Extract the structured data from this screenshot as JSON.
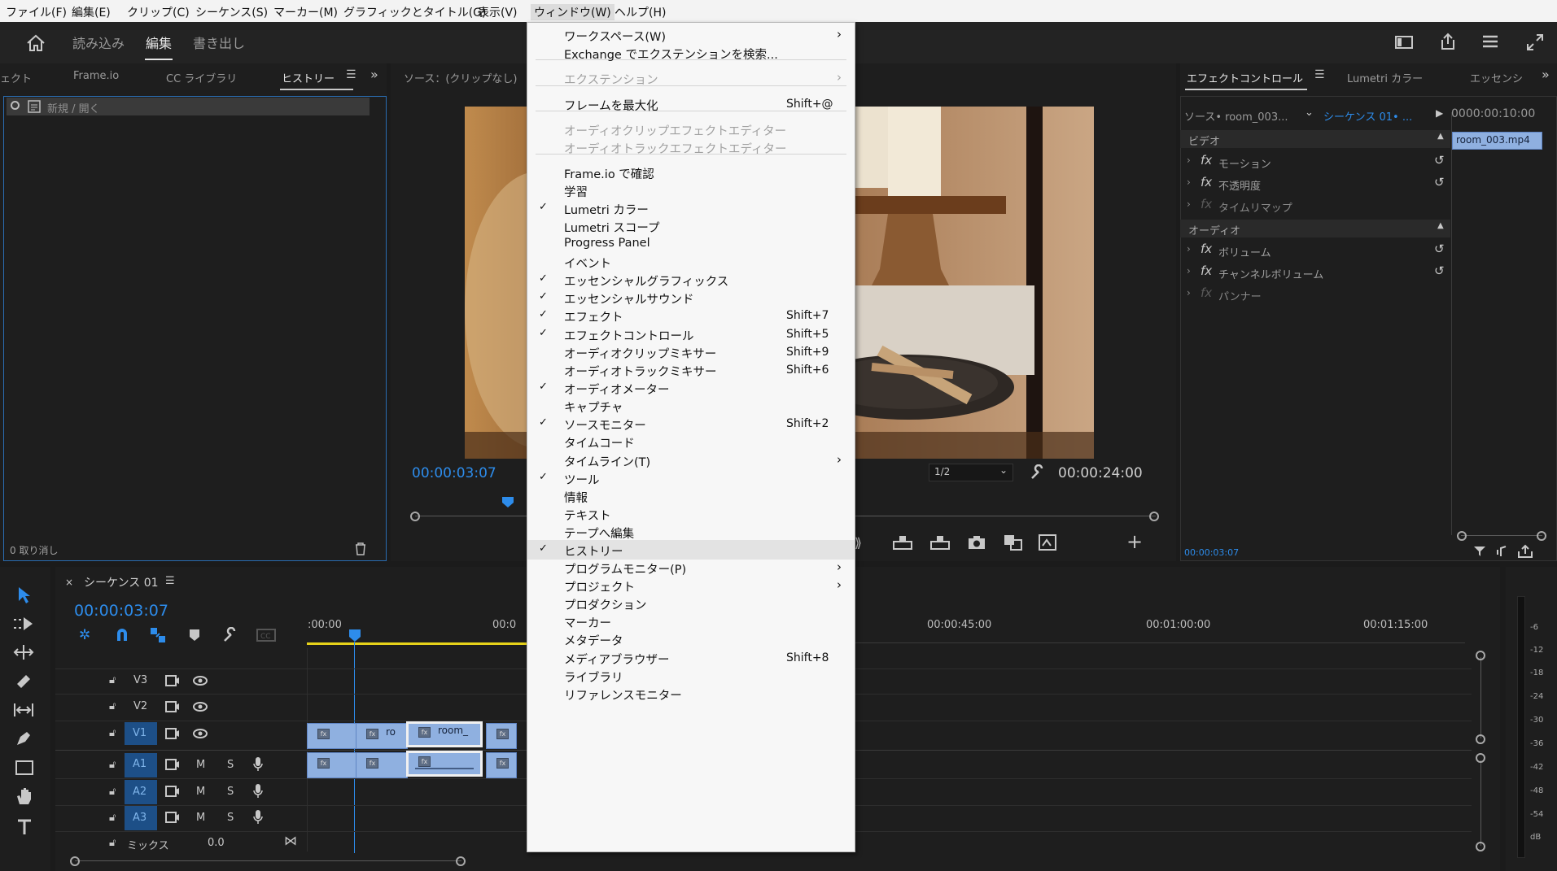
{
  "menubar": {
    "file": "ファイル(F)",
    "edit": "編集(E)",
    "clip": "クリップ(C)",
    "sequence": "シーケンス(S)",
    "marker": "マーカー(M)",
    "graphics": "グラフィックとタイトル(G)",
    "view": "表示(V)",
    "window": "ウィンドウ(W)",
    "help": "ヘルプ(H)"
  },
  "header": {
    "import": "読み込み",
    "edit": "編集",
    "export": "書き出し"
  },
  "left_panel": {
    "tabs": [
      "ェクト",
      "Frame.io",
      "CC ライブラリ",
      "ヒストリー"
    ],
    "history_item": "新規 / 開く",
    "undo_count": "0 取り消し"
  },
  "source_monitor": {
    "title": "ソース：(クリップなし)",
    "timecode": "00:00:03:07",
    "zoom": "1/2",
    "duration": "00:00:24:00"
  },
  "effect_controls": {
    "tabs": [
      "エフェクトコントロール",
      "Lumetri カラー",
      "エッセンシ"
    ],
    "source": "ソース• room_003...",
    "sequence": "シーケンス 01• ...",
    "ruler_time": "0000:00:10:00",
    "clip_name": "room_003.mp4",
    "video_header": "ビデオ",
    "audio_header": "オーディオ",
    "items_video": [
      "モーション",
      "不透明度",
      "タイムリマップ"
    ],
    "items_audio": [
      "ボリューム",
      "チャンネルボリューム",
      "パンナー"
    ],
    "fx_label": "fx",
    "current_time": "00:00:03:07"
  },
  "window_menu": {
    "items": [
      {
        "label": "ワークスペース(W)",
        "submenu": true
      },
      {
        "label": "Exchange でエクステンションを検索..."
      },
      {
        "label": "エクステンション",
        "disabled": true,
        "submenu": true
      },
      {
        "label": "フレームを最大化",
        "shortcut": "Shift+@"
      },
      {
        "label": "オーディオクリップエフェクトエディター",
        "disabled": true
      },
      {
        "label": "オーディオトラックエフェクトエディター",
        "disabled": true
      },
      {
        "label": "Frame.io で確認"
      },
      {
        "label": "学習"
      },
      {
        "label": "Lumetri カラー",
        "checked": true
      },
      {
        "label": "Lumetri スコープ"
      },
      {
        "label": "Progress Panel"
      },
      {
        "label": "イベント"
      },
      {
        "label": "エッセンシャルグラフィックス",
        "checked": true
      },
      {
        "label": "エッセンシャルサウンド",
        "checked": true
      },
      {
        "label": "エフェクト",
        "checked": true,
        "shortcut": "Shift+7"
      },
      {
        "label": "エフェクトコントロール",
        "checked": true,
        "shortcut": "Shift+5"
      },
      {
        "label": "オーディオクリップミキサー",
        "shortcut": "Shift+9"
      },
      {
        "label": "オーディオトラックミキサー",
        "shortcut": "Shift+6"
      },
      {
        "label": "オーディオメーター",
        "checked": true
      },
      {
        "label": "キャプチャ"
      },
      {
        "label": "ソースモニター",
        "checked": true,
        "shortcut": "Shift+2"
      },
      {
        "label": "タイムコード"
      },
      {
        "label": "タイムライン(T)",
        "submenu": true
      },
      {
        "label": "ツール",
        "checked": true
      },
      {
        "label": "情報"
      },
      {
        "label": "テキスト"
      },
      {
        "label": "テープへ編集"
      },
      {
        "label": "ヒストリー",
        "checked": true,
        "highlighted": true
      },
      {
        "label": "プログラムモニター(P)",
        "submenu": true
      },
      {
        "label": "プロジェクト",
        "submenu": true
      },
      {
        "label": "プロダクション"
      },
      {
        "label": "マーカー"
      },
      {
        "label": "メタデータ"
      },
      {
        "label": "メディアブラウザー",
        "shortcut": "Shift+8"
      },
      {
        "label": "ライブラリ"
      },
      {
        "label": "リファレンスモニター"
      }
    ]
  },
  "timeline": {
    "sequence_name": "シーケンス 01",
    "timecode": "00:00:03:07",
    "ruler": [
      ":00:00",
      "00:0",
      "00:00:45:00",
      "00:01:00:00",
      "00:01:15:00"
    ],
    "tracks_video": [
      "V3",
      "V2",
      "V1"
    ],
    "tracks_audio": [
      "A1",
      "A2",
      "A3"
    ],
    "mute": "M",
    "solo": "S",
    "mix_label": "ミックス",
    "mix_value": "0.0",
    "clip_labels": [
      "ro",
      "room_"
    ]
  },
  "meter": {
    "scale": [
      "-6",
      "-12",
      "-18",
      "-24",
      "-30",
      "-36",
      "-42",
      "-48",
      "-54",
      "dB"
    ]
  },
  "colors": {
    "accent_blue": "#2d8ceb",
    "clip_blue": "#8fb0e0",
    "playhead": "#2d8ceb"
  }
}
